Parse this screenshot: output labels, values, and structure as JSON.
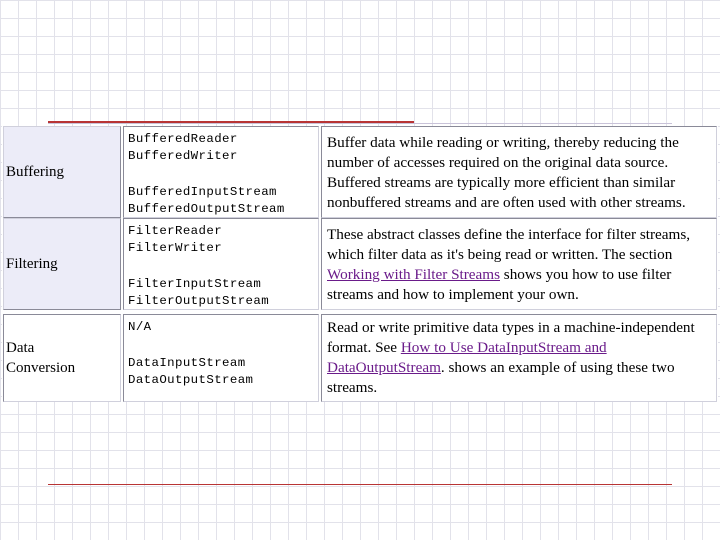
{
  "table": {
    "rows": [
      {
        "category": "Buffering",
        "classes_top": [
          "BufferedReader",
          "BufferedWriter"
        ],
        "classes_bottom": [
          "BufferedInputStream",
          "BufferedOutputStream"
        ],
        "description": {
          "before": "Buffer data while reading or writing, thereby reducing the number of accesses required on the original data source. Buffered streams are typically more efficient than similar nonbuffered streams and are often used with other streams.",
          "link": "",
          "after": ""
        }
      },
      {
        "category": "Filtering",
        "classes_top": [
          "FilterReader",
          "FilterWriter"
        ],
        "classes_bottom": [
          "FilterInputStream",
          "FilterOutputStream"
        ],
        "description": {
          "before": "These abstract classes define the interface for filter streams, which filter data as it's being read or written. The section ",
          "link": "Working with Filter Streams",
          "after": " shows you how to use filter streams and how to implement your own."
        }
      },
      {
        "category_line1": "Data",
        "category_line2": "Conversion",
        "classes_top": [
          "N/A"
        ],
        "classes_bottom": [
          "DataInputStream",
          "DataOutputStream"
        ],
        "description": {
          "before": "Read or write primitive data types in a machine-independent format. See ",
          "link": "How to Use DataInputStream and DataOutputStream",
          "after": ". shows an example of using these two streams."
        }
      }
    ]
  }
}
